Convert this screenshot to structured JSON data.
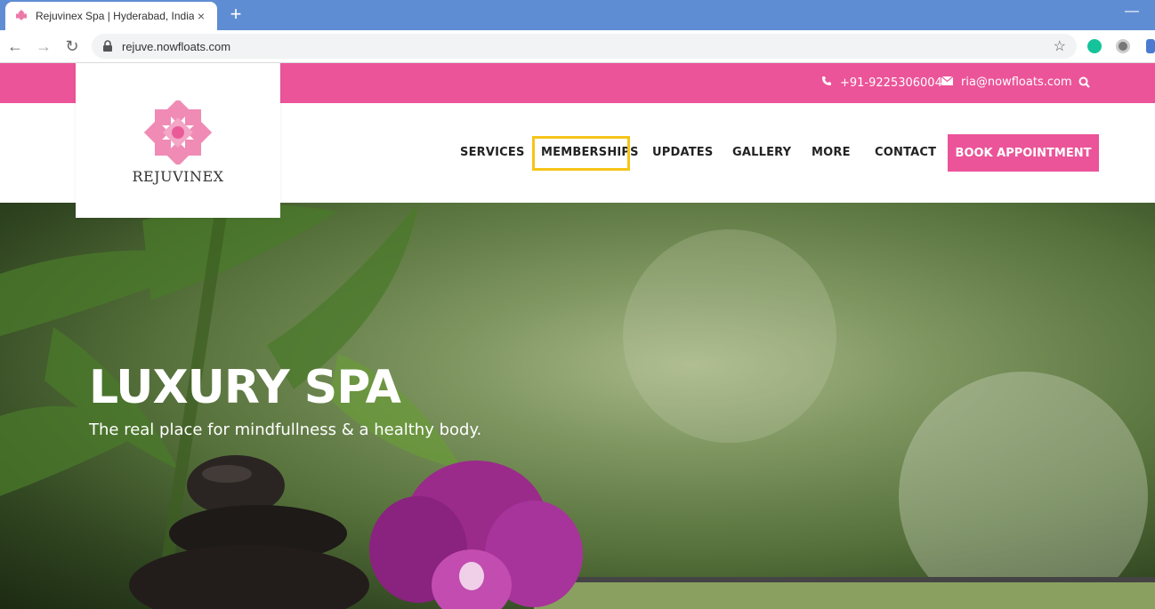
{
  "browser": {
    "tab_title": "Rejuvinex Spa | Hyderabad, India",
    "tab_close": "×",
    "new_tab": "+",
    "minimize": "—",
    "url": "rejuve.nowfloats.com",
    "back": "←",
    "forward": "→",
    "reload": "↻",
    "star": "☆"
  },
  "topbar": {
    "phone": "+91-9225306004",
    "email": "ria@nowfloats.com"
  },
  "logo": {
    "text": "REJUVINEX"
  },
  "nav": {
    "items": [
      "SERVICES",
      "MEMBERSHIPS",
      "UPDATES",
      "GALLERY",
      "MORE",
      "CONTACT"
    ],
    "cta": "BOOK APPOINTMENT"
  },
  "hero": {
    "title": "LUXURY SPA",
    "subtitle": "The real place for mindfullness & a healthy body."
  },
  "colors": {
    "brand_pink": "#eb5499",
    "highlight": "#f5c518",
    "chrome_blue": "#5f8dd3"
  }
}
